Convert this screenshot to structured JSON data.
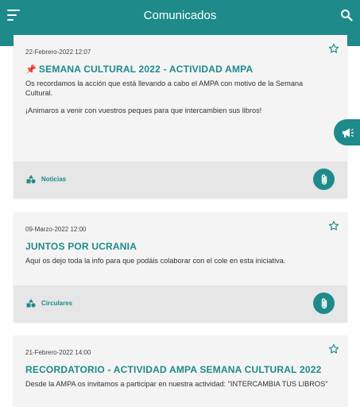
{
  "appbar": {
    "title": "Comunicados"
  },
  "icons": {
    "menu": "menu-icon",
    "search": "search-icon",
    "star": "star-outline-icon",
    "category": "shapes-icon",
    "attachment": "paperclip-icon",
    "pin": "pushpin-icon",
    "megaphone": "megaphone-icon"
  },
  "colors": {
    "primary": "#1e8a8a",
    "card": "#f4f4f4",
    "footer": "#e6e6e6"
  },
  "cards": [
    {
      "date": "22-Febrero-2022 12:07",
      "title": "SEMANA CULTURAL 2022 - ACTIVIDAD AMPA",
      "pinned": true,
      "body": [
        "Os recordamos la acción que está llevando a cabo el AMPA con motivo de la Semana Cultural.",
        "¡Animaros a venir con vuestros peques para que intercambien sus libros!"
      ],
      "category": "Noticias"
    },
    {
      "date": "09-Marzo-2022 12:00",
      "title": "JUNTOS POR UCRANIA",
      "pinned": false,
      "body": [
        "Aquí os dejo toda la info para que podáis colaborar con el cole en esta iniciativa."
      ],
      "category": "Circulares"
    },
    {
      "date": "21-Febrero-2022 14:00",
      "title": "RECORDATORIO - ACTIVIDAD AMPA SEMANA CULTURAL 2022",
      "pinned": false,
      "body": [
        "Desde la AMPA os invitamos a participar en nuestra actividad: \"INTERCAMBIA TUS LIBROS\""
      ]
    }
  ]
}
